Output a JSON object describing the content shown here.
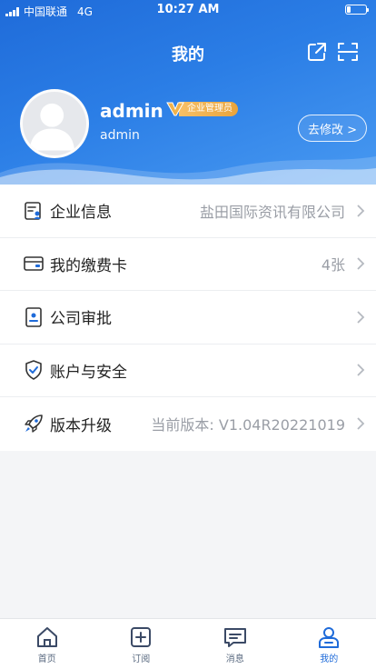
{
  "status_bar": {
    "carrier": "中国联通",
    "network": "4G",
    "time": "10:27 AM"
  },
  "header": {
    "title": "我的"
  },
  "profile": {
    "name": "admin",
    "badge": "企业管理员",
    "account": "admin",
    "edit_label": "去修改 >"
  },
  "menu": [
    {
      "label": "企业信息",
      "value": "盐田国际资讯有限公司",
      "icon": "company-info-icon"
    },
    {
      "label": "我的缴费卡",
      "value": "4张",
      "icon": "card-icon"
    },
    {
      "label": "公司审批",
      "value": "",
      "icon": "approval-icon"
    },
    {
      "label": "账户与安全",
      "value": "",
      "icon": "shield-icon"
    },
    {
      "label": "版本升级",
      "value": "当前版本: V1.04R20221019",
      "icon": "rocket-icon"
    }
  ],
  "tabs": [
    {
      "label": "首页",
      "icon": "home-icon"
    },
    {
      "label": "订阅",
      "icon": "subscribe-icon"
    },
    {
      "label": "消息",
      "icon": "message-icon"
    },
    {
      "label": "我的",
      "icon": "profile-icon",
      "active": true
    }
  ],
  "colors": {
    "primary": "#1f6bd9",
    "badge": "#eaa43c"
  }
}
